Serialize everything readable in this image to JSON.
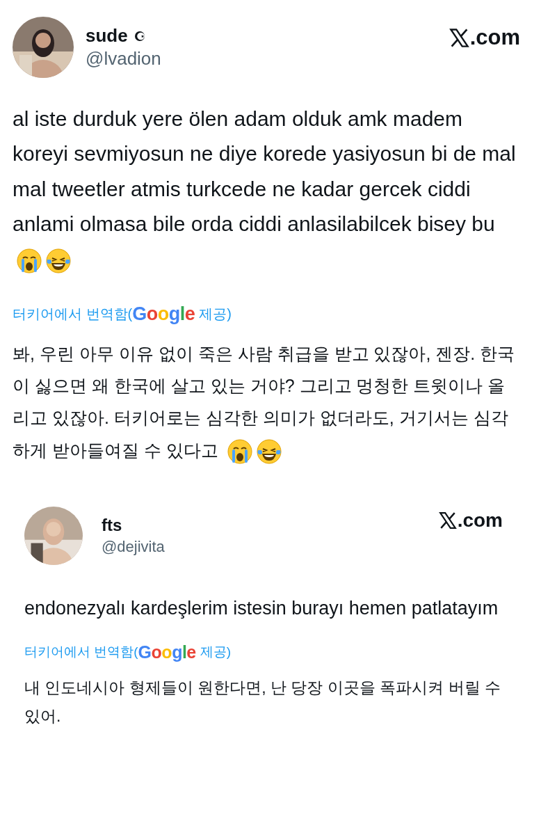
{
  "posts": [
    {
      "name": "sude",
      "has_badge": true,
      "handle": "@lvadion",
      "site": ".com",
      "text": "al iste durduk yere ölen adam olduk amk madem koreyi sevmiyosun ne diye korede yasiyosun bi de mal mal tweetler atmis turkcede ne kadar gercek ciddi anlami olmasa bile orda ciddi anlasilabilcek bisey bu",
      "emojis": [
        {
          "kind": "crying"
        },
        {
          "kind": "laughing"
        }
      ],
      "translation_prefix": "터키어에서 번역함(",
      "translation_brand": "Google",
      "translation_suffix": "제공)",
      "translation": "봐, 우린 아무 이유 없이 죽은 사람 취급을 받고 있잖아, 젠장. 한국이 싫으면 왜 한국에 살고 있는 거야? 그리고 멍청한 트윗이나 올리고 있잖아. 터키어로는 심각한 의미가 없더라도, 거기서는 심각하게 받아들여질 수 있다고",
      "translation_emojis": [
        {
          "kind": "crying"
        },
        {
          "kind": "laughing"
        }
      ]
    },
    {
      "name": "fts",
      "handle": "@dejivita",
      "site": ".com",
      "text": "endonezyalı kardeşlerim istesin burayı hemen patlatayım",
      "translation_prefix": "터키어에서 번역함(",
      "translation_brand": "Google",
      "translation_suffix": "제공)",
      "translation": "내 인도네시아 형제들이 원한다면, 난 당장 이곳을 폭파시켜 버릴 수 있어."
    }
  ]
}
